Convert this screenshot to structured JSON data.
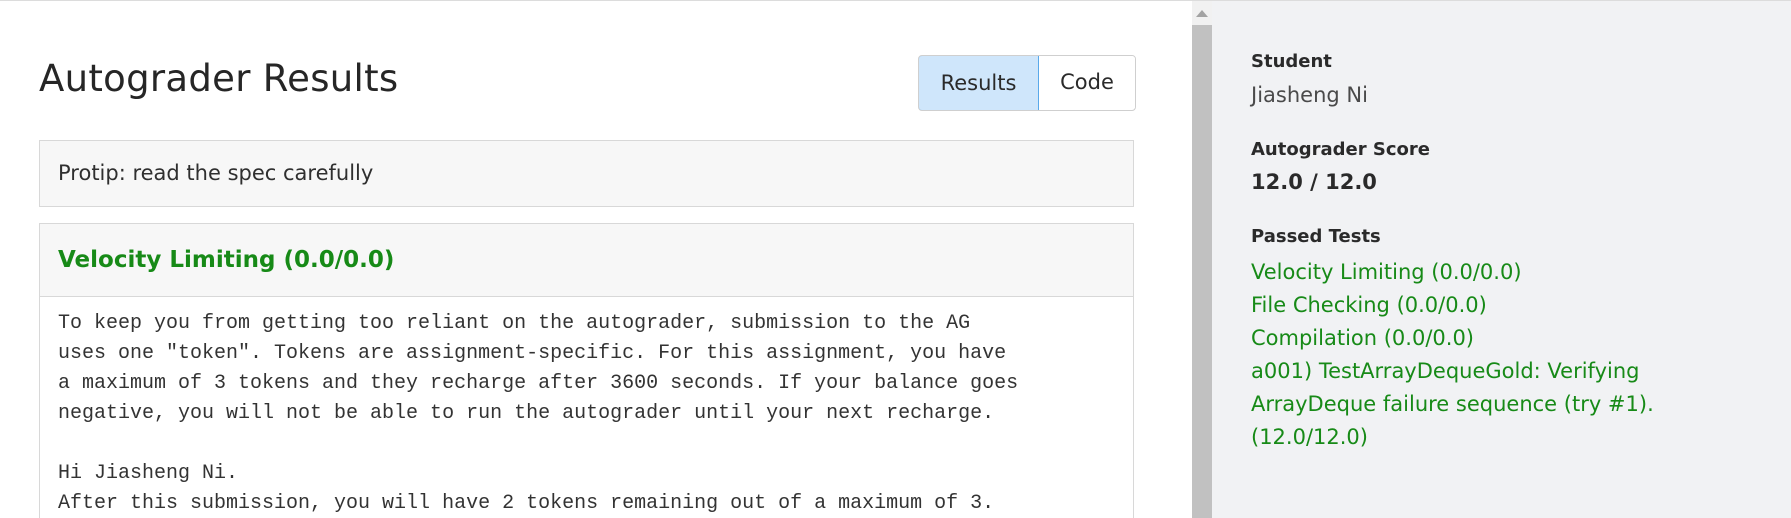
{
  "main": {
    "title": "Autograder Results",
    "tabs": [
      {
        "label": "Results",
        "active": true
      },
      {
        "label": "Code",
        "active": false
      }
    ],
    "protip": "Protip: read the spec carefully",
    "test": {
      "title": "Velocity Limiting (0.0/0.0)",
      "output_lines": [
        "To keep you from getting too reliant on the autograder, submission to the AG",
        "uses one \"token\". Tokens are assignment-specific. For this assignment, you have",
        "a maximum of 3 tokens and they recharge after 3600 seconds. If your balance goes",
        "negative, you will not be able to run the autograder until your next recharge.",
        "",
        "Hi Jiasheng Ni.",
        "After this submission, you will have 2 tokens remaining out of a maximum of 3."
      ]
    }
  },
  "sidebar": {
    "student_label": "Student",
    "student_name": "Jiasheng Ni",
    "score_label": "Autograder Score",
    "score_value": "12.0 / 12.0",
    "passed_label": "Passed Tests",
    "passed_tests": [
      "Velocity Limiting (0.0/0.0)",
      "File Checking (0.0/0.0)",
      "Compilation (0.0/0.0)",
      "a001) TestArrayDequeGold: Verifying ArrayDeque failure sequence (try #1). (12.0/12.0)"
    ]
  },
  "colors": {
    "pass_green": "#178a17",
    "active_tab_bg": "#cfe6fb",
    "active_tab_border": "#5aa9ea",
    "sidebar_bg": "#f1f2f4"
  },
  "icons": {
    "scroll_up": "scroll-up-arrow-icon"
  }
}
